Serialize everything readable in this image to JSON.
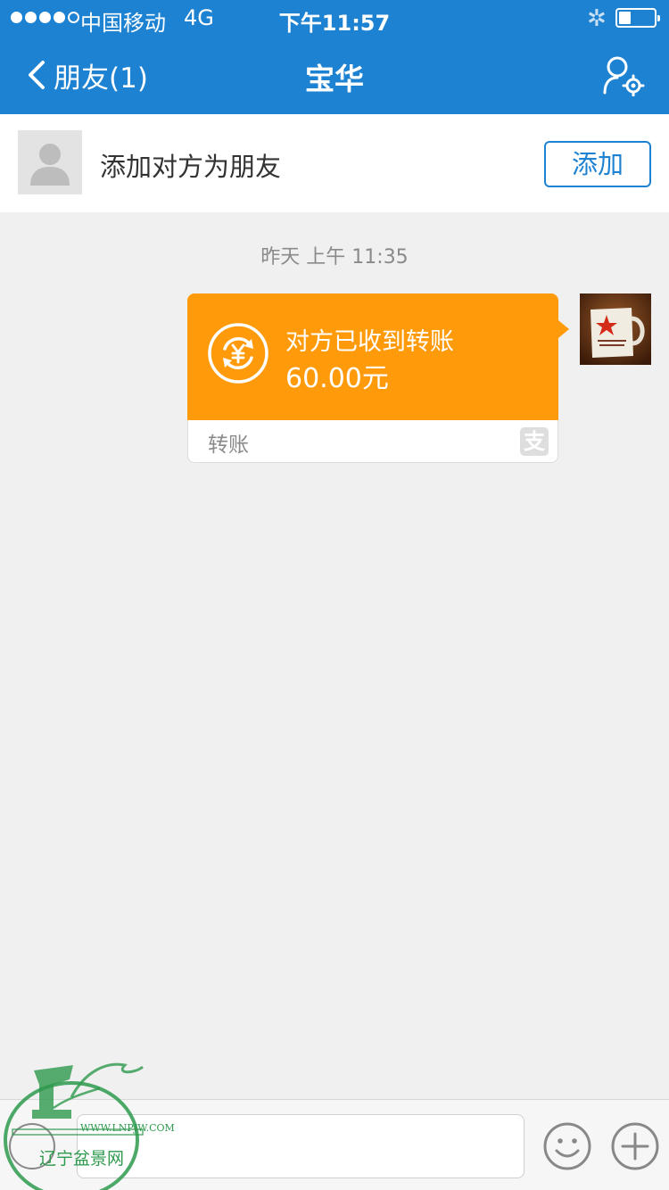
{
  "status_bar": {
    "carrier": "中国移动",
    "network": "4G",
    "time": "下午11:57",
    "signal_bars_filled": 4,
    "signal_bars_total": 5,
    "battery_level": 0.3
  },
  "nav": {
    "back_label": "朋友(1)",
    "title": "宝华",
    "back_icon": "chevron-left-icon",
    "settings_icon": "user-settings-icon"
  },
  "add_friend_banner": {
    "text": "添加对方为朋友",
    "button_label": "添加"
  },
  "chat": {
    "timestamp": "昨天 上午 11:35",
    "transfer_card": {
      "status": "对方已收到转账",
      "amount": "60.00元",
      "label": "转账",
      "icon": "yuan-transfer-icon",
      "brand_icon": "alipay-icon",
      "brand_glyph": "支"
    }
  },
  "input_bar": {
    "placeholder": "",
    "voice_icon": "voice-icon",
    "emoji_icon": "emoji-icon",
    "plus_icon": "plus-icon"
  },
  "watermark": {
    "url": "WWW.LNPJW.COM",
    "name": "辽宁盆景网"
  },
  "colors": {
    "header_blue": "#1e82d2",
    "transfer_orange": "#ff9a0a",
    "background": "#f0f0f0"
  }
}
